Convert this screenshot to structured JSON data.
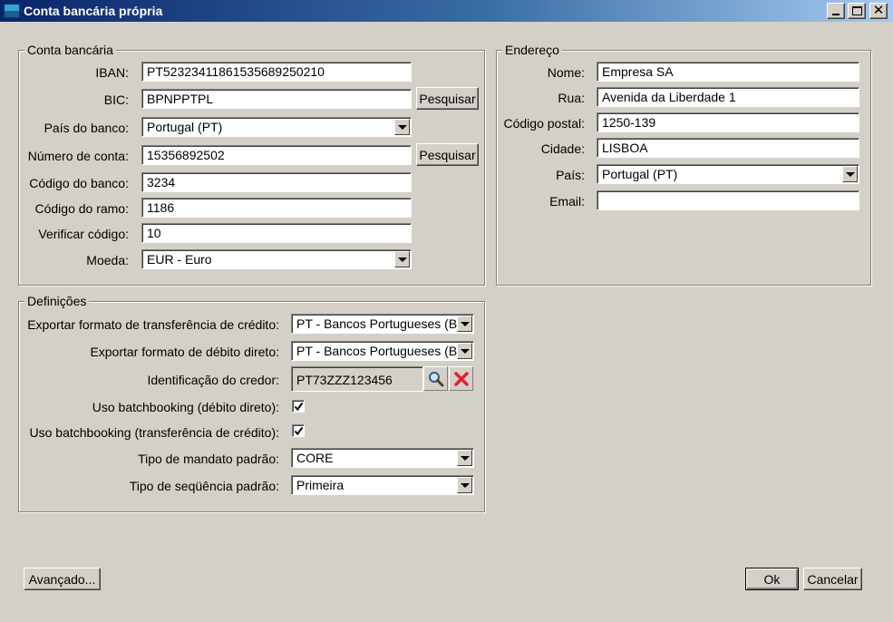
{
  "window": {
    "title": "Conta bancária própria",
    "controls": {
      "minimize": "minimize",
      "maximize": "maximize",
      "close": "✕"
    }
  },
  "account": {
    "group_title": "Conta bancária",
    "iban_label": "IBAN:",
    "iban_value": "PT52323411861535689250210",
    "bic_label": "BIC:",
    "bic_value": "BPNPPTPL",
    "search_label": "Pesquisar",
    "country_label": "País do banco:",
    "country_value": "Portugal (PT)",
    "account_number_label": "Número de conta:",
    "account_number_value": "15356892502",
    "bank_code_label": "Código do banco:",
    "bank_code_value": "3234",
    "branch_code_label": "Código do ramo:",
    "branch_code_value": "1186",
    "check_code_label": "Verificar código:",
    "check_code_value": "10",
    "currency_label": "Moeda:",
    "currency_value": "EUR - Euro"
  },
  "address": {
    "group_title": "Endereço",
    "name_label": "Nome:",
    "name_value": "Empresa SA",
    "street_label": "Rua:",
    "street_value": "Avenida da Liberdade 1",
    "postal_label": "Código postal:",
    "postal_value": "1250-139",
    "city_label": "Cidade:",
    "city_value": "LISBOA",
    "country_label": "País:",
    "country_value": "Portugal (PT)",
    "email_label": "Email:",
    "email_value": ""
  },
  "settings": {
    "group_title": "Definições",
    "credit_format_label": "Exportar formato de transferência de crédito:",
    "credit_format_value": "PT - Bancos Portugueses (Bc",
    "debit_format_label": "Exportar formato de débito direto:",
    "debit_format_value": "PT - Bancos Portugueses (Bc",
    "creditor_id_label": "Identificação do credor:",
    "creditor_id_value": "PT73ZZZ123456",
    "batch_debit_label": "Uso batchbooking (débito direto):",
    "batch_debit_checked": true,
    "batch_credit_label": "Uso batchbooking (transferência de crédito):",
    "batch_credit_checked": true,
    "mandate_type_label": "Tipo de mandato padrão:",
    "mandate_type_value": "CORE",
    "sequence_type_label": "Tipo de seqüência padrão:",
    "sequence_type_value": "Primeira"
  },
  "footer": {
    "advanced_label": "Avançado...",
    "ok_label": "Ok",
    "cancel_label": "Cancelar"
  },
  "icons": {
    "magnifier": "magnifier-icon",
    "delete": "red-x-icon",
    "check": "checkmark-icon"
  }
}
